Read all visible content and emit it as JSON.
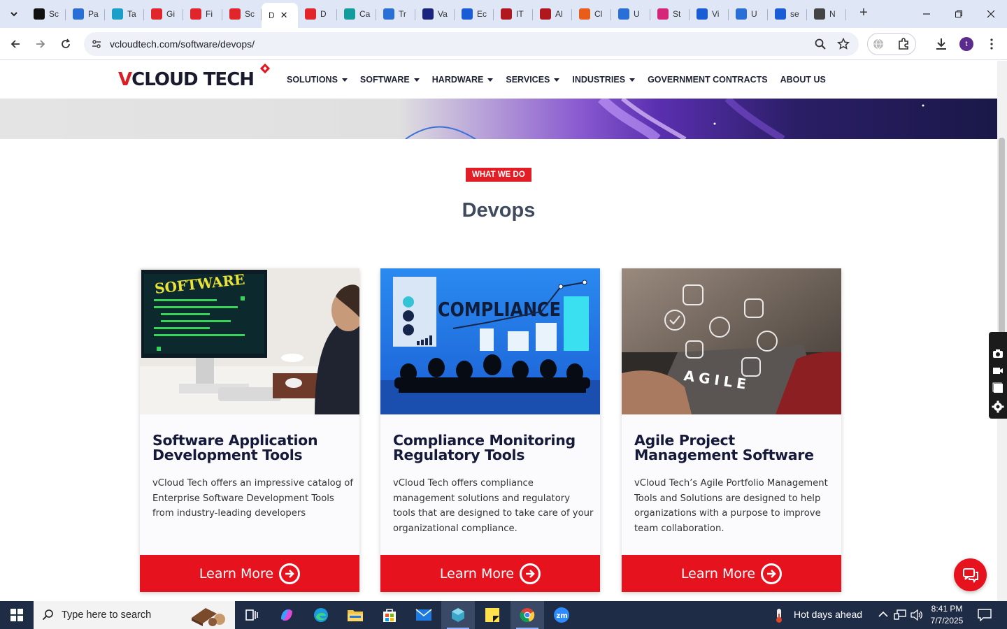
{
  "browser": {
    "tabs": [
      {
        "label": "Sc",
        "color": "#111"
      },
      {
        "label": "Pa",
        "color": "#2a6fd6"
      },
      {
        "label": "Ta",
        "color": "#1aa0c8"
      },
      {
        "label": "Gi",
        "color": "#e0262b"
      },
      {
        "label": "Fi",
        "color": "#e0262b"
      },
      {
        "label": "Sc",
        "color": "#e0262b"
      },
      {
        "label": "D",
        "color": "#fff",
        "active": true
      },
      {
        "label": "D",
        "color": "#e0262b"
      },
      {
        "label": "Ca",
        "color": "#149c9c"
      },
      {
        "label": "Tr",
        "color": "#2a6fd6"
      },
      {
        "label": "Va",
        "color": "#1a237e"
      },
      {
        "label": "Ec",
        "color": "#1a5bd6"
      },
      {
        "label": "IT",
        "color": "#b0171f"
      },
      {
        "label": "Al",
        "color": "#b0171f"
      },
      {
        "label": "Cl",
        "color": "#e85d1a"
      },
      {
        "label": "U",
        "color": "#2a6fd6"
      },
      {
        "label": "St",
        "color": "#d6267a"
      },
      {
        "label": "Vi",
        "color": "#1a5bd6"
      },
      {
        "label": "U",
        "color": "#2a6fd6"
      },
      {
        "label": "se",
        "color": "#1a5bd6"
      },
      {
        "label": "N",
        "color": "#444"
      }
    ],
    "url": "vcloudtech.com/software/devops/"
  },
  "site": {
    "logo_text_v": "V",
    "logo_text_rest": "CLOUD TECH",
    "nav": [
      {
        "label": "SOLUTIONS",
        "has_caret": true
      },
      {
        "label": "SOFTWARE",
        "has_caret": true
      },
      {
        "label": "HARDWARE",
        "has_caret": true
      },
      {
        "label": "SERVICES",
        "has_caret": true
      },
      {
        "label": "INDUSTRIES",
        "has_caret": true
      },
      {
        "label": "GOVERNMENT CONTRACTS",
        "has_caret": false
      },
      {
        "label": "ABOUT US",
        "has_caret": false
      }
    ],
    "badge": "WHAT WE DO",
    "section_title": "Devops",
    "cards": [
      {
        "image_alt": "SOFTWARE",
        "title": "Software Application Development Tools",
        "description": "vCloud Tech offers an impressive catalog of Enterprise Software Development Tools from industry-leading developers",
        "button": "Learn More"
      },
      {
        "image_alt": "COMPLIANCE",
        "title": "Compliance Monitoring Regulatory Tools",
        "description": "vCloud Tech offers compliance management solutions and regulatory tools that are designed to take care of your organizational compliance.",
        "button": "Learn More"
      },
      {
        "image_alt": "AGILE",
        "title": "Agile Project Management Software",
        "description": "vCloud Tech’s Agile Portfolio Management Tools and Solutions are designed to help organizations with a purpose to improve team collaboration.",
        "button": "Learn More"
      }
    ],
    "colors": {
      "accent": "#e6121d",
      "title": "#3f4a5e",
      "card_title": "#15193a"
    }
  },
  "taskbar": {
    "search_placeholder": "Type here to search",
    "weather": "Hot days ahead",
    "time": "8:41 PM",
    "date": "7/7/2025"
  }
}
